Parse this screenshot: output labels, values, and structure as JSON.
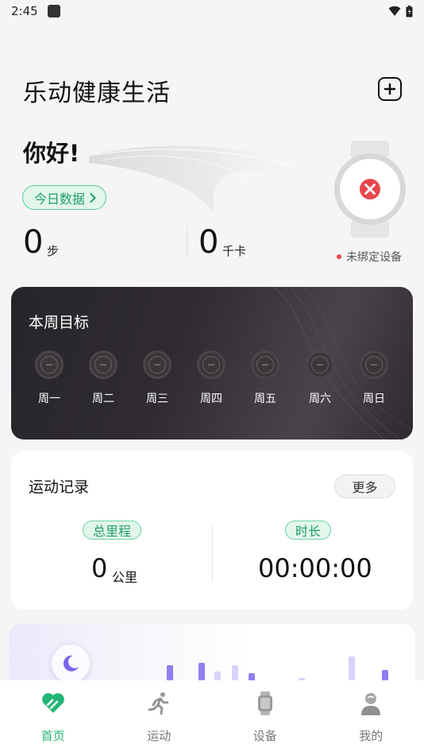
{
  "status": {
    "time": "2:45"
  },
  "app": {
    "title": "乐动健康生活"
  },
  "summary": {
    "greeting": "你好!",
    "today_button": "今日数据",
    "steps_value": "0",
    "steps_unit": "步",
    "kcal_value": "0",
    "kcal_unit": "千卡",
    "device_status": "未绑定设备"
  },
  "weekly_goal": {
    "title": "本周目标",
    "days": [
      "周一",
      "周二",
      "周三",
      "周四",
      "周五",
      "周六",
      "周日"
    ]
  },
  "exercise_record": {
    "title": "运动记录",
    "more_label": "更多",
    "distance_tag": "总里程",
    "distance_value": "0",
    "distance_unit": "公里",
    "duration_tag": "时长",
    "duration_value": "00:00:00"
  },
  "tabs": [
    {
      "label": "首页",
      "active": true,
      "icon": "heart-icon"
    },
    {
      "label": "运动",
      "active": false,
      "icon": "running-icon"
    },
    {
      "label": "设备",
      "active": false,
      "icon": "watch-icon"
    },
    {
      "label": "我的",
      "active": false,
      "icon": "profile-icon"
    }
  ],
  "colors": {
    "accent": "#22b575",
    "alert": "#e8474c",
    "sleep_bar": "#8f7ff2"
  }
}
